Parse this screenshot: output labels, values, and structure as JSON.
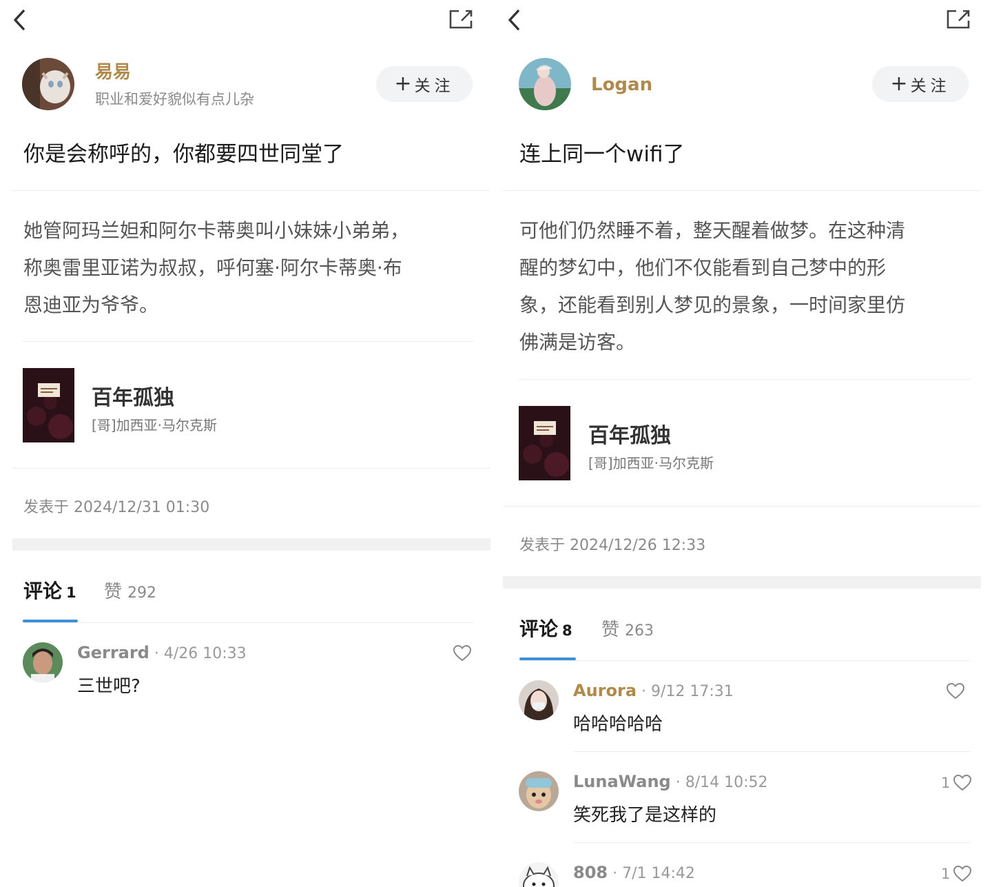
{
  "left": {
    "author": {
      "name": "易易",
      "bio": "职业和爱好貌似有点儿杂"
    },
    "follow_label": "关注",
    "post_title": "你是会称呼的，你都要四世同堂了",
    "quote_lines": [
      "她管阿玛兰妲和阿尔卡蒂奥叫小妹妹小弟弟，",
      "称奥雷里亚诺为叔叔，呼何塞·阿尔卡蒂奥·布",
      "恩迪亚为爷爷。"
    ],
    "book": {
      "title": "百年孤独",
      "author": "[哥]加西亚·马尔克斯"
    },
    "posted": "发表于 2024/12/31 01:30",
    "tabs": {
      "comments_label": "评论",
      "comments_count": "1",
      "likes_label": "赞",
      "likes_count": "292"
    },
    "comments": [
      {
        "name": "Gerrard",
        "time": "· 4/26 10:33",
        "text": "三世吧?",
        "likes": ""
      }
    ]
  },
  "right": {
    "author": {
      "name": "Logan"
    },
    "follow_label": "关注",
    "post_title": "连上同一个wifi了",
    "quote_lines": [
      "可他们仍然睡不着，整天醒着做梦。在这种清",
      "醒的梦幻中，他们不仅能看到自己梦中的形",
      "象，还能看到别人梦见的景象，一时间家里仿",
      "佛满是访客。"
    ],
    "book": {
      "title": "百年孤独",
      "author": "[哥]加西亚·马尔克斯"
    },
    "posted": "发表于 2024/12/26 12:33",
    "tabs": {
      "comments_label": "评论",
      "comments_count": "8",
      "likes_label": "赞",
      "likes_count": "263"
    },
    "comments": [
      {
        "name": "Aurora",
        "time": "· 9/12 17:31",
        "text": "哈哈哈哈哈",
        "likes": ""
      },
      {
        "name": "LunaWang",
        "time": "· 8/14 10:52",
        "text": "笑死我了是这样的",
        "likes": "1"
      },
      {
        "name": "808",
        "time": "· 7/1 14:42",
        "text": "",
        "likes": "1"
      }
    ]
  },
  "icons": {
    "back": "chevron-left-icon",
    "share": "share-icon",
    "plus": "plus-icon",
    "like": "heart-icon"
  },
  "colors": {
    "name_gold": "#b08a4a",
    "tab_underline": "#3f8fd6",
    "muted_text": "#8a8a8a",
    "follow_bg": "#f2f3f4"
  }
}
